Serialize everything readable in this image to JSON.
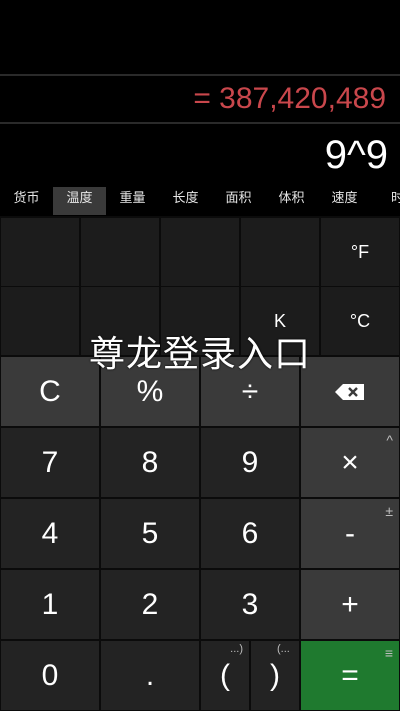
{
  "display": {
    "result": "= 387,420,489",
    "expression": "9^9"
  },
  "tabs": [
    "货币",
    "温度",
    "重量",
    "长度",
    "面积",
    "体积",
    "速度",
    "时"
  ],
  "active_tab": 1,
  "units": {
    "fahrenheit": "°F",
    "kelvin": "K",
    "celsius": "°C"
  },
  "keys": {
    "clear": "C",
    "percent": "%",
    "divide": "÷",
    "backspace": "⌫",
    "seven": "7",
    "eight": "8",
    "nine": "9",
    "multiply": "×",
    "multiply_alt": "^",
    "four": "4",
    "five": "5",
    "six": "6",
    "minus": "-",
    "minus_alt": "±",
    "one": "1",
    "two": "2",
    "three": "3",
    "plus": "+",
    "zero": "0",
    "dot": ".",
    "lparen": "(",
    "rparen": ")",
    "lparen_alt": "...)",
    "rparen_alt": "(...",
    "equals": "=",
    "equals_alt": "≡"
  },
  "overlay_text": "尊龙登录入口",
  "colors": {
    "result": "#c9474c",
    "equals_bg": "#1f7a2f"
  }
}
